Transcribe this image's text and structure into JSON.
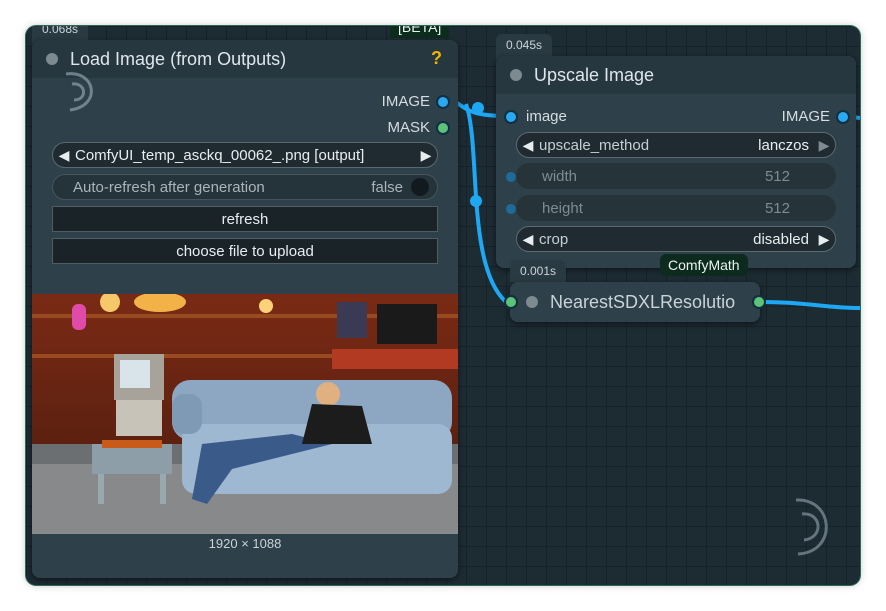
{
  "load_image_node": {
    "time": "0.068s",
    "title": "Load Image (from Outputs)",
    "help": "?",
    "beta_badge": "[BETA]",
    "outputs": [
      "IMAGE",
      "MASK"
    ],
    "image_combo": {
      "value": "ComfyUI_temp_asckq_00062_.png [output]"
    },
    "auto_refresh": {
      "label": "Auto-refresh after generation",
      "value": "false"
    },
    "refresh_label": "refresh",
    "upload_label": "choose file to upload",
    "image_size": "1920 × 1088"
  },
  "upscale_node": {
    "time": "0.045s",
    "title": "Upscale Image",
    "input": "image",
    "output": "IMAGE",
    "upscale_method": {
      "label": "upscale_method",
      "value": "lanczos"
    },
    "width": {
      "label": "width",
      "value": "512"
    },
    "height": {
      "label": "height",
      "value": "512"
    },
    "crop": {
      "label": "crop",
      "value": "disabled"
    }
  },
  "nearest_node": {
    "time": "0.001s",
    "title": "NearestSDXLResolutio",
    "badge": "ComfyMath"
  },
  "colors": {
    "link": "#1ea7f2",
    "canvas": "#1d2b33",
    "node": "#2e4049"
  }
}
